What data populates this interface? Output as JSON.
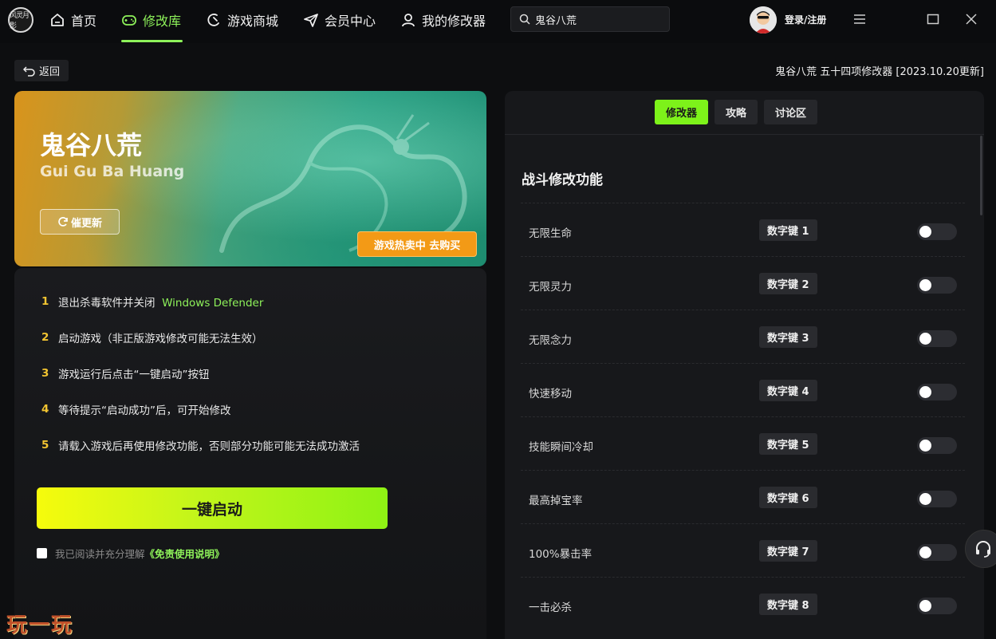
{
  "app": {
    "logo_text": "风灵月影"
  },
  "nav": {
    "items": [
      {
        "label": "首页",
        "icon": "home-icon"
      },
      {
        "label": "修改库",
        "icon": "gamepad-icon",
        "active": true
      },
      {
        "label": "游戏商城",
        "icon": "shop-icon"
      },
      {
        "label": "会员中心",
        "icon": "send-icon"
      },
      {
        "label": "我的修改器",
        "icon": "user-icon"
      }
    ]
  },
  "search": {
    "value": "鬼谷八荒",
    "placeholder": ""
  },
  "user": {
    "login_label": "登录/注册"
  },
  "subheader": {
    "back_label": "返回",
    "title": "鬼谷八荒 五十四项修改器 [2023.10.20更新]"
  },
  "banner": {
    "title": "鬼谷八荒",
    "subtitle": "Gui Gu Ba Huang",
    "update_label": "催更新",
    "buy_label": "游戏热卖中 去购买"
  },
  "steps": [
    {
      "num": "1",
      "text": "退出杀毒软件并关闭",
      "highlight": "Windows Defender"
    },
    {
      "num": "2",
      "text": "启动游戏（非正版游戏修改可能无法生效）",
      "highlight": ""
    },
    {
      "num": "3",
      "text": "游戏运行后点击“一键启动”按钮",
      "highlight": ""
    },
    {
      "num": "4",
      "text": "等待提示“启动成功”后，可开始修改",
      "highlight": ""
    },
    {
      "num": "5",
      "text": "请载入游戏后再使用修改功能，否则部分功能可能无法成功激活",
      "highlight": ""
    }
  ],
  "launch_label": "一键启动",
  "agree": {
    "text": "我已阅读并充分理解",
    "link": "《免责使用说明》",
    "checked": false
  },
  "watermark": "玩一玩",
  "right": {
    "tabs": [
      {
        "label": "修改器",
        "active": true
      },
      {
        "label": "攻略",
        "active": false
      },
      {
        "label": "讨论区",
        "active": false
      }
    ],
    "section_title": "战斗修改功能",
    "rows": [
      {
        "label": "无限生命",
        "key": "数字键 1",
        "enabled": false
      },
      {
        "label": "无限灵力",
        "key": "数字键 2",
        "enabled": false
      },
      {
        "label": "无限念力",
        "key": "数字键 3",
        "enabled": false
      },
      {
        "label": "快速移动",
        "key": "数字键 4",
        "enabled": false
      },
      {
        "label": "技能瞬间冷却",
        "key": "数字键 5",
        "enabled": false
      },
      {
        "label": "最高掉宝率",
        "key": "数字键 6",
        "enabled": false
      },
      {
        "label": "100%暴击率",
        "key": "数字键 7",
        "enabled": false
      },
      {
        "label": "一击必杀",
        "key": "数字键 8",
        "enabled": false
      }
    ]
  },
  "colors": {
    "accent": "#8ef25a",
    "step_number": "#f3c531",
    "buy": "#f39a16"
  }
}
